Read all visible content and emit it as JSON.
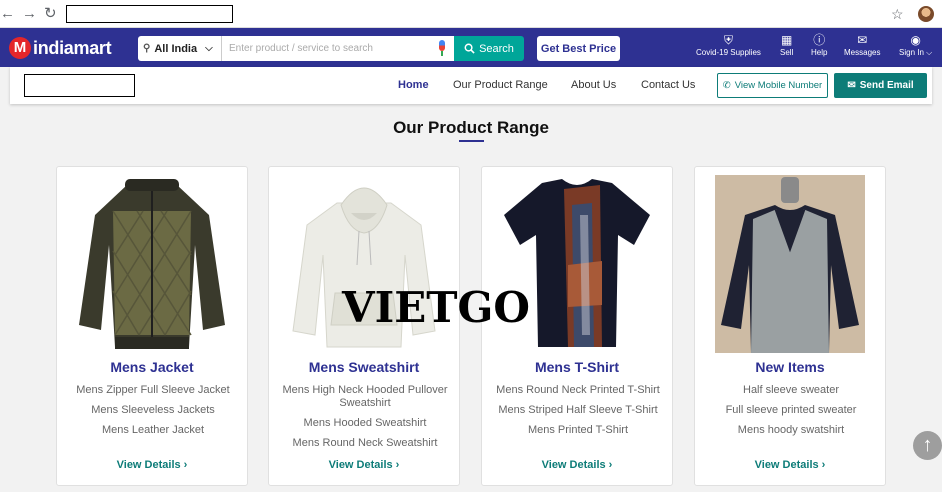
{
  "browser": {
    "back_icon": "←",
    "forward_icon": "→",
    "reload_icon": "↻",
    "star_icon": "☆"
  },
  "header": {
    "logo_letter": "M",
    "logo_text": "indiamart",
    "location": "All India",
    "search_placeholder": "Enter product / service to search",
    "search_label": "Search",
    "best_price_label": "Get Best Price",
    "links": [
      {
        "label": "Covid-19 Supplies",
        "icon": "shield-plus-icon"
      },
      {
        "label": "Sell",
        "icon": "store-icon"
      },
      {
        "label": "Help",
        "icon": "help-icon"
      },
      {
        "label": "Messages",
        "icon": "messages-icon"
      },
      {
        "label": "Sign In",
        "icon": "user-icon"
      }
    ]
  },
  "subnav": {
    "home": "Home",
    "product_range": "Our Product Range",
    "about": "About Us",
    "contact": "Contact Us",
    "view_mobile": "View Mobile Number",
    "send_email": "Send Email"
  },
  "section": {
    "title": "Our Product Range"
  },
  "cards": [
    {
      "name": "Mens Jacket",
      "items": [
        "Mens Zipper Full Sleeve Jacket",
        "Mens Sleeveless Jackets",
        "Mens Leather Jacket"
      ],
      "details": "View Details"
    },
    {
      "name": "Mens Sweatshirt",
      "items": [
        "Mens High Neck Hooded Pullover Sweatshirt",
        "Mens Hooded Sweatshirt",
        "Mens Round Neck Sweatshirt"
      ],
      "details": "View Details"
    },
    {
      "name": "Mens T-Shirt",
      "items": [
        "Mens Round Neck Printed T-Shirt",
        "Mens Striped Half Sleeve T-Shirt",
        "Mens Printed T-Shirt"
      ],
      "details": "View Details"
    },
    {
      "name": "New Items",
      "items": [
        "Half sleeve sweater",
        "Full sleeve printed sweater",
        "Mens hoody swatshirt"
      ],
      "details": "View Details"
    }
  ],
  "watermark": "VIETGO",
  "colors": {
    "brand_blue": "#2e3192",
    "teal": "#0d7c78",
    "search_teal": "#00a699",
    "logo_red": "#e4262a"
  }
}
